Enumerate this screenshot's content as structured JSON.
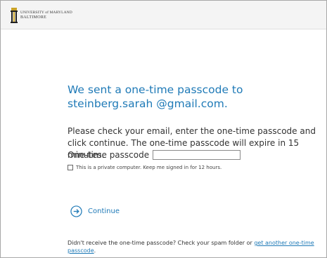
{
  "header": {
    "logo_line1": "UNIVERSITY of MARYLAND",
    "logo_line2": "BALTIMORE",
    "logo_icon": "umb-mace-logo-icon"
  },
  "main": {
    "heading_line1": "We sent a one-time passcode to",
    "heading_line2": "steinberg.sarah @gmail.com.",
    "instructions": "Please check your email, enter the one-time passcode and click continue. The one-time passcode will expire in 15 minutes.",
    "otp_label": "One-time passcode",
    "otp_value": "",
    "remember_label": "This is a private computer. Keep me signed in for 12 hours.",
    "remember_checked": false,
    "continue_label": "Continue",
    "continue_icon": "arrow-circle-right-icon",
    "footer_text": "Didn't receive the one-time passcode? Check your spam folder or ",
    "footer_link": "get another one-time passcode",
    "footer_end": "."
  },
  "colors": {
    "accent": "#1f7ab7",
    "text": "#333333",
    "header_bg": "#f4f4f4",
    "logo_gold": "#c9a227"
  }
}
